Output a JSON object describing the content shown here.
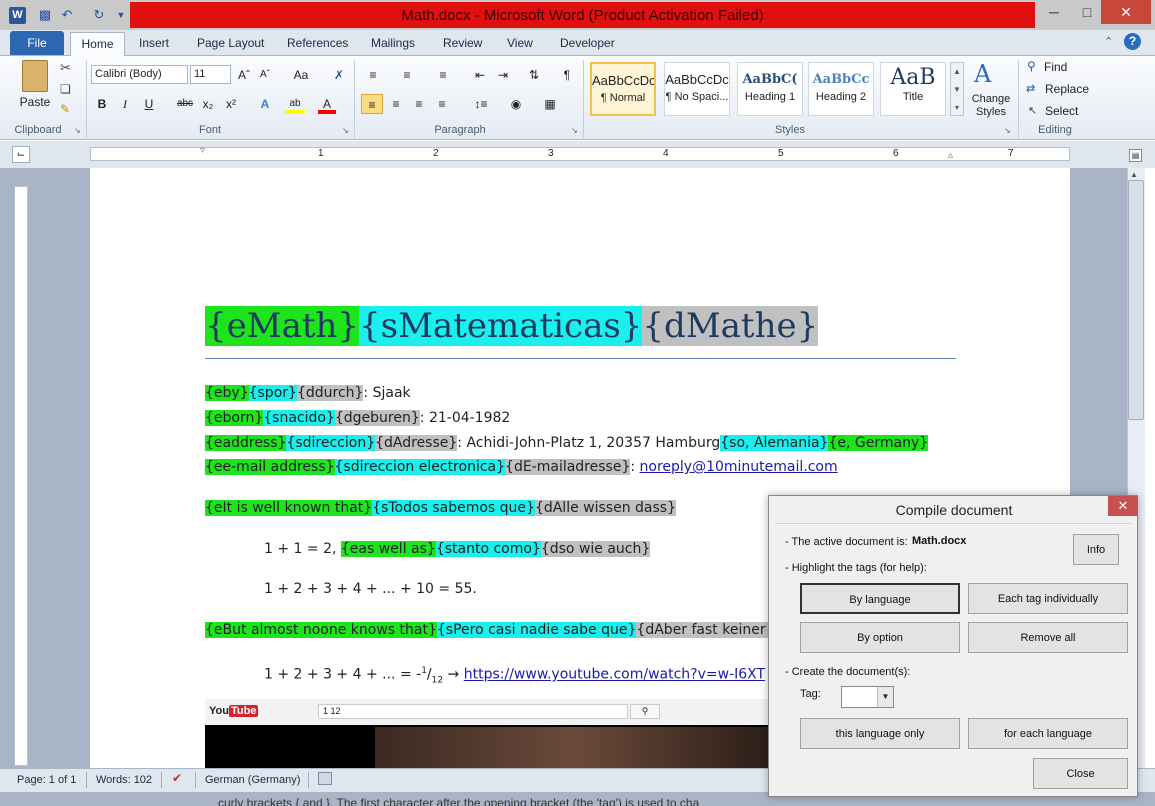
{
  "window": {
    "title": "Math.docx - Microsoft Word (Product Activation Failed)",
    "minimize": "─",
    "maximize": "□",
    "close": "✕"
  },
  "tabs": {
    "file": "File",
    "home": "Home",
    "insert": "Insert",
    "page_layout": "Page Layout",
    "references": "References",
    "mailings": "Mailings",
    "review": "Review",
    "view": "View",
    "developer": "Developer"
  },
  "clipboard": {
    "paste": "Paste",
    "label": "Clipboard"
  },
  "font": {
    "name": "Calibri (Body)",
    "size": "11",
    "label": "Font"
  },
  "paragraph": {
    "label": "Paragraph"
  },
  "styles": {
    "label": "Styles",
    "items": [
      {
        "preview": "AaBbCcDc",
        "name": "¶ Normal"
      },
      {
        "preview": "AaBbCcDc",
        "name": "¶ No Spaci..."
      },
      {
        "preview": "AaBbC(",
        "name": "Heading 1"
      },
      {
        "preview": "AaBbCc",
        "name": "Heading 2"
      },
      {
        "preview": "AaB",
        "name": "Title"
      }
    ],
    "change_styles": "Change Styles"
  },
  "editing": {
    "label": "Editing",
    "find": "Find",
    "replace": "Replace",
    "select": "Select"
  },
  "ruler": {
    "numbers": [
      "1",
      "2",
      "3",
      "4",
      "5",
      "6",
      "7"
    ]
  },
  "doc": {
    "title": [
      "{eMath}",
      "{sMatematicas}",
      "{dMathe}"
    ],
    "l1": [
      "{eby}",
      "{spor}",
      "{ddurch}",
      ": Sjaak"
    ],
    "l2": [
      "{eborn}",
      "{snacido}",
      "{dgeburen}",
      ": 21-04-1982"
    ],
    "l3": [
      "{eaddress}",
      "{sdireccion}",
      "{dAdresse}",
      ": Achidi-John-Platz 1, 20357 Hamburg",
      "{so, Alemania}",
      "{e, Germany}"
    ],
    "l4": [
      "{ee-mail address}",
      "{sdireccion electronica}",
      "{dE-mailadresse}",
      ": ",
      "noreply@10minutemail.com"
    ],
    "l5": [
      "{eIt is well known that}",
      "{sTodos sabemos que}",
      "{dAlle wissen dass}"
    ],
    "l6": [
      "1 + 1 = 2, ",
      "{eas well as}",
      "{stanto como}",
      "{dso wie auch}"
    ],
    "l7": "1 + 2 + 3 + 4 + ... + 10 = 55.",
    "l8": [
      "{eBut almost noone knows that}",
      "{sPero casi nadie sabe que}",
      "{dAber fast keiner w"
    ],
    "l9": [
      "1 + 2 + 3 + 4 + ... = -",
      "1",
      "/",
      "12",
      " → ",
      "https://www.youtube.com/watch?v=w-I6XT"
    ],
    "yt_logo": "YouTube",
    "yt_search": "1 12",
    "bottom_text": "curly brackets { and }. The first character after the opening bracket (the 'tag') is used to cha"
  },
  "status": {
    "page": "Page: 1 of 1",
    "words": "Words: 102",
    "language": "German (Germany)"
  },
  "dialog": {
    "title": "Compile document",
    "close": "✕",
    "active_label": "- The active document is:",
    "active_value": "Math.docx",
    "info": "Info",
    "highlight_label": "- Highlight the tags (for help):",
    "by_language": "By language",
    "each_tag": "Each tag individually",
    "by_option": "By option",
    "remove_all": "Remove all",
    "create_label": "- Create the document(s):",
    "tag_label": "Tag:",
    "tag_value": "",
    "this_language": "this language only",
    "each_language": "for each language",
    "close_btn": "Close"
  }
}
